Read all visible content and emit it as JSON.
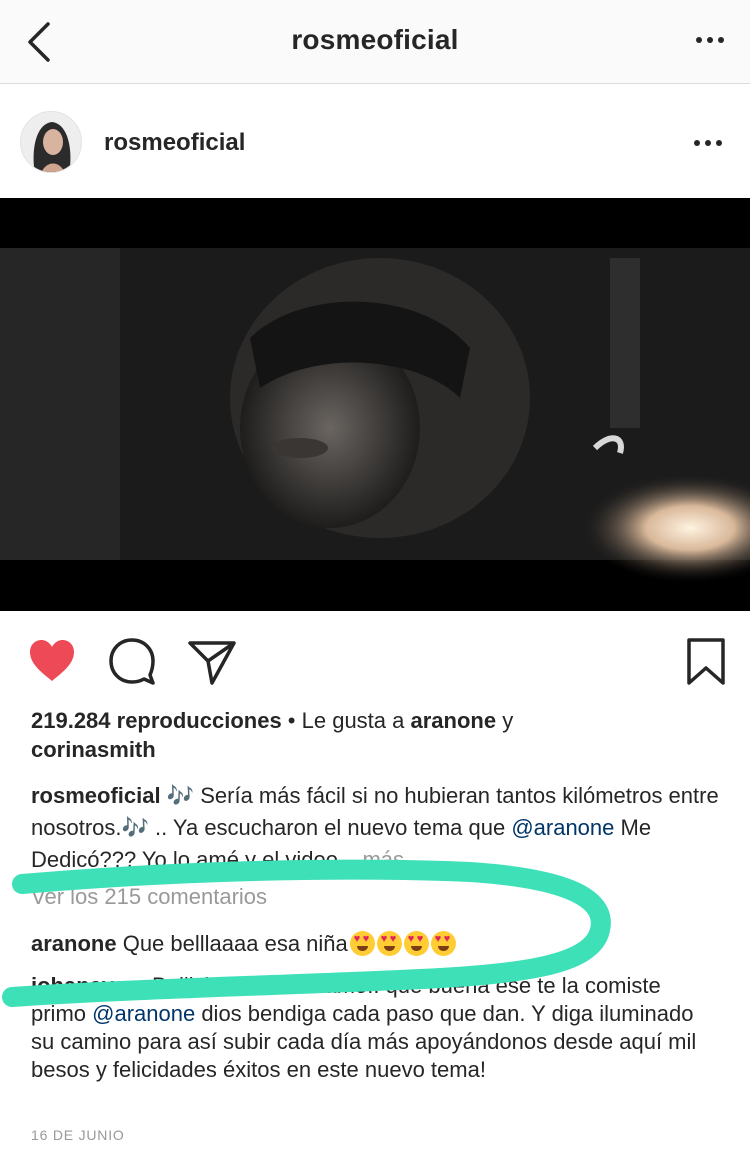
{
  "nav": {
    "title": "rosmeoficial",
    "back_icon": "chevron-left-icon",
    "more_icon": "more-horizontal-icon"
  },
  "post": {
    "username": "rosmeoficial"
  },
  "actions": {
    "like_icon": "heart-filled-icon",
    "comment_icon": "comment-icon",
    "share_icon": "send-icon",
    "save_icon": "bookmark-icon",
    "like_color": "#ed4956"
  },
  "stats": {
    "views": "219.284 reproducciones",
    "separator": " • ",
    "liked_by_prefix": "Le gusta a ",
    "liked_user": "aranone",
    "and": " y",
    "liked_user2": "corinasmith"
  },
  "caption": {
    "username": "rosmeoficial",
    "part1": " 🎶 Sería más fácil si no hubieran tantos kilómetros entre nosotros.🎶 .. Ya escucharon el nuevo tema que ",
    "mention": "@aranone",
    "part2": " Me Dedicó??? Yo lo amé y el video... ",
    "more": "más"
  },
  "comments": {
    "view_all": "Ver los 215 comentarios",
    "items": [
      {
        "username": "aranone",
        "text": " Que belllaaaa esa niña"
      },
      {
        "username": "johanavam",
        "text_a": " Bellisimossss los amo.. qué buena ese te la comiste primo ",
        "mention": "@aranone",
        "text_b": " dios bendiga cada paso que dan. Y diga iluminado su camino para así subir cada día más apoyándonos desde aquí mil besos y felicidades éxitos en este nuevo tema!"
      }
    ]
  },
  "date": "16 DE JUNIO",
  "colors": {
    "mention": "#003569",
    "meta": "#999999",
    "highlight": "#3ee0b8"
  }
}
